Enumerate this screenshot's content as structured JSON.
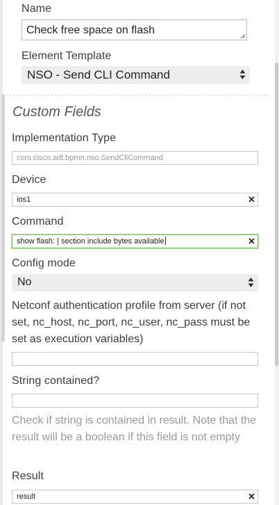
{
  "name": {
    "label": "Name",
    "value": "Check free space on flash"
  },
  "element_template": {
    "label": "Element Template",
    "value": "NSO - Send CLI Command"
  },
  "custom_fields": {
    "title": "Custom Fields",
    "implementation_type": {
      "label": "Implementation Type",
      "value": "com.cisco.adt.bpmn.nso.SendCliCommand"
    },
    "device": {
      "label": "Device",
      "value": "ios1"
    },
    "command": {
      "label": "Command",
      "value": "show flash: | section include bytes available"
    },
    "config_mode": {
      "label": "Config mode",
      "value": "No"
    },
    "netconf_profile": {
      "label": "Netconf authentication profile from server (if not set, nc_host, nc_port, nc_user, nc_pass must be set as execution variables)",
      "value": ""
    },
    "string_contained": {
      "label": "String contained?",
      "value": "",
      "help": "Check if string is contained in result. Note that the result will be a boolean if this field is not empty"
    },
    "result": {
      "label": "Result",
      "value": "result"
    }
  },
  "icons": {
    "clear": "close-icon",
    "select_arrows": "up-down-arrows-icon",
    "resize": "resize-grip-icon"
  },
  "colors": {
    "focus_border": "#7dc35b",
    "select_bg": "#ededed"
  }
}
